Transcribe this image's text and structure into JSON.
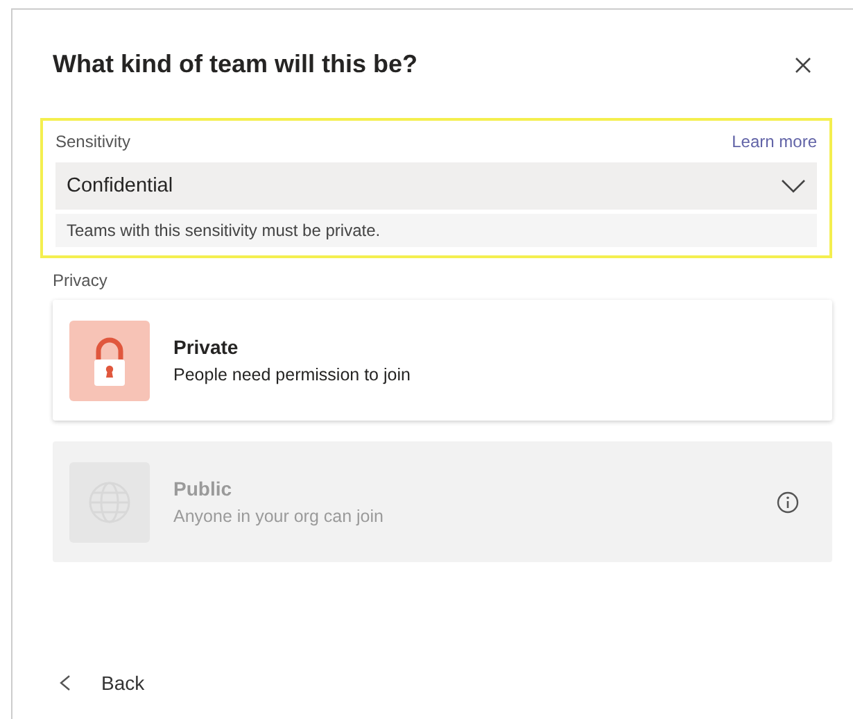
{
  "dialog": {
    "title": "What kind of team will this be?"
  },
  "sensitivity": {
    "label": "Sensitivity",
    "link": "Learn more",
    "highlighted": true,
    "value": "Confidential",
    "note": "Teams with this sensitivity must be private."
  },
  "privacy": {
    "label": "Privacy",
    "options": [
      {
        "kind": "lock",
        "title": "Private",
        "description": "People need permission to join",
        "disabled": false,
        "info": false
      },
      {
        "kind": "globe",
        "title": "Public",
        "description": "Anyone in your org can join",
        "disabled": true,
        "info": true
      }
    ]
  },
  "back": {
    "label": "Back"
  }
}
